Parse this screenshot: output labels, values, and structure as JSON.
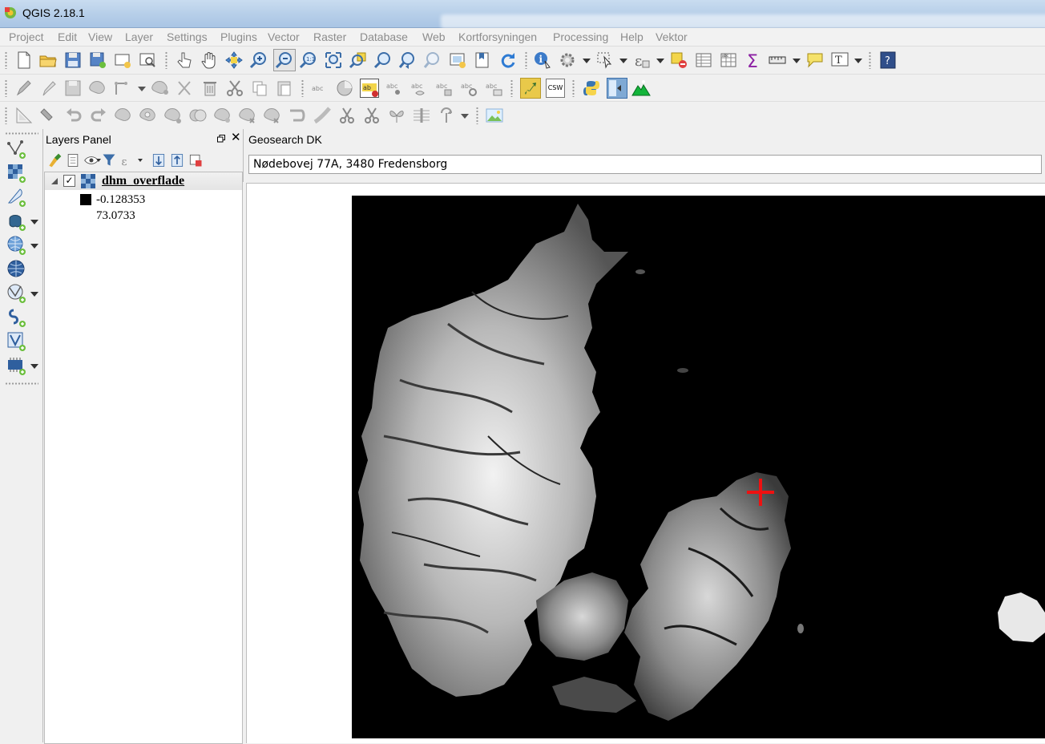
{
  "window": {
    "title": "QGIS 2.18.1"
  },
  "menus": [
    "Project",
    "Edit",
    "View",
    "Layer",
    "Settings",
    "Plugins",
    "Vector",
    "Raster",
    "Database",
    "Web",
    "Kortforsyningen",
    "Processing",
    "Help",
    "Vektor"
  ],
  "toolbars": {
    "row1_icons": [
      "new-project-icon",
      "open-project-icon",
      "save-project-icon",
      "save-as-icon",
      "new-print-composer-icon",
      "composer-manager-icon",
      "touch-zoom-icon",
      "pan-icon",
      "pan-to-selection-icon",
      "zoom-in-icon",
      "zoom-out-icon",
      "zoom-native-icon",
      "zoom-full-icon",
      "zoom-to-selection-icon",
      "zoom-to-layer-icon",
      "zoom-last-icon",
      "zoom-next-icon",
      "new-map-view-icon",
      "new-bookmark-icon",
      "refresh-icon",
      "identify-icon",
      "action-icon",
      "select-icon",
      "expression-select-icon",
      "deselect-icon",
      "attribute-table-icon",
      "field-calculator-icon",
      "statistics-icon",
      "measure-icon",
      "map-tips-icon",
      "text-annotation-icon",
      "help-icon"
    ],
    "row2_icons": [
      "current-edits-icon",
      "toggle-editing-icon",
      "save-edits-icon",
      "add-feature-icon",
      "move-feature-icon",
      "node-tool-icon",
      "delete-selected-icon",
      "cut-features-icon",
      "copy-features-icon",
      "paste-features-icon",
      "label-icon",
      "diagram-icon",
      "highlight-label-icon",
      "pin-label-icon",
      "show-hide-label-icon",
      "move-label-icon",
      "rotate-label-icon",
      "change-label-icon",
      "plugin-installer-icon",
      "csw-icon",
      "python-console-icon",
      "georeferencer-icon",
      "terrain-icon"
    ],
    "row3_icons": [
      "digitize-icon",
      "snap-icon",
      "undo-icon",
      "redo-icon",
      "simplify-icon",
      "add-ring-icon",
      "add-part-icon",
      "fill-ring-icon",
      "delete-ring-icon",
      "delete-part-icon",
      "reshape-icon",
      "offset-curve-icon",
      "split-features-icon",
      "split-parts-icon",
      "merge-features-icon",
      "merge-attributes-icon",
      "rotate-point-icon",
      "image-icon"
    ],
    "csw_label": "CSW"
  },
  "left_toolbar_icons": [
    "add-vector-layer-icon",
    "add-raster-layer-icon",
    "add-delimited-text-icon",
    "add-postgis-icon",
    "add-spatialite-icon",
    "add-wms-icon",
    "add-wfs-icon",
    "add-wcs-icon",
    "add-virtual-layer-icon"
  ],
  "layers_panel": {
    "title": "Layers Panel",
    "close_label": "✕",
    "layers": [
      {
        "name": "dhm_overflade",
        "checked": true,
        "legend_min": "-0.128353",
        "legend_max": "73.0733"
      }
    ]
  },
  "geosearch": {
    "title": "Geosearch DK",
    "value": "Nødebovej 77A, 3480 Fredensborg"
  }
}
